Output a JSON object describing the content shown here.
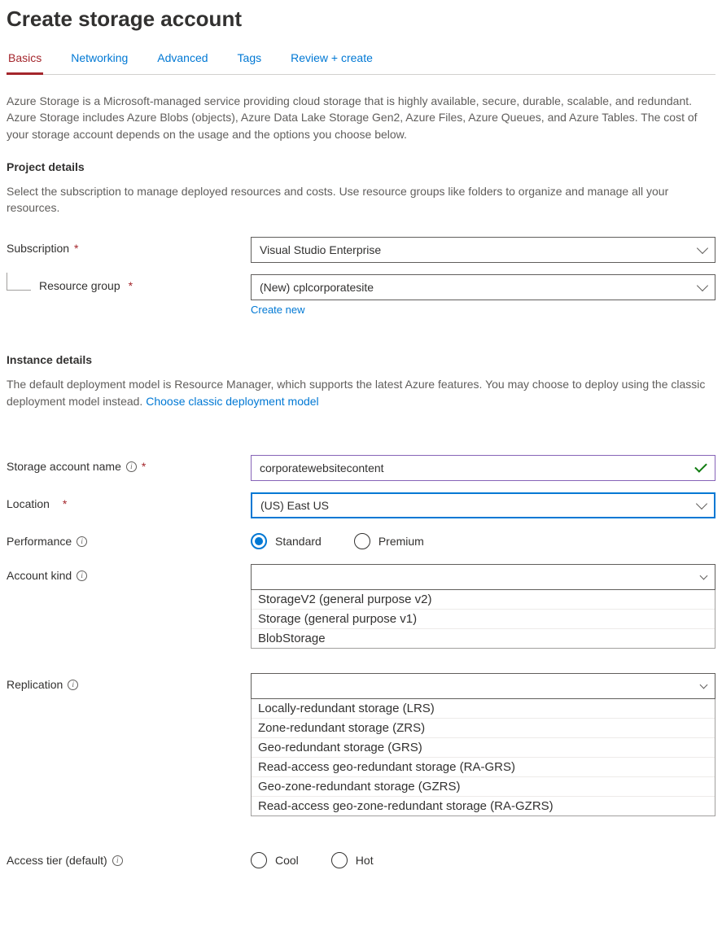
{
  "header": {
    "title": "Create storage account"
  },
  "tabs": [
    "Basics",
    "Networking",
    "Advanced",
    "Tags",
    "Review + create"
  ],
  "intro": "Azure Storage is a Microsoft-managed service providing cloud storage that is highly available, secure, durable, scalable, and redundant. Azure Storage includes Azure Blobs (objects), Azure Data Lake Storage Gen2, Azure Files, Azure Queues, and Azure Tables. The cost of your storage account depends on the usage and the options you choose below.",
  "project": {
    "heading": "Project details",
    "desc": "Select the subscription to manage deployed resources and costs. Use resource groups like folders to organize and manage all your resources.",
    "subscription_label": "Subscription",
    "subscription_value": "Visual Studio Enterprise",
    "resource_group_label": "Resource group",
    "resource_group_value": "(New) cplcorporatesite",
    "create_new": "Create new"
  },
  "instance": {
    "heading": "Instance details",
    "desc_prefix": "The default deployment model is Resource Manager, which supports the latest Azure features. You may choose to deploy using the classic deployment model instead.  ",
    "desc_link": "Choose classic deployment model",
    "name_label": "Storage account name",
    "name_value": "corporatewebsitecontent",
    "location_label": "Location",
    "location_value": "(US) East US",
    "performance_label": "Performance",
    "performance_options": [
      "Standard",
      "Premium"
    ],
    "performance_selected": "Standard",
    "account_kind_label": "Account kind",
    "account_kind_value": "",
    "account_kind_options": [
      "StorageV2 (general purpose v2)",
      "Storage (general purpose v1)",
      "BlobStorage"
    ],
    "replication_label": "Replication",
    "replication_value": "",
    "replication_options": [
      "Locally-redundant storage (LRS)",
      "Zone-redundant storage (ZRS)",
      "Geo-redundant storage (GRS)",
      "Read-access geo-redundant storage (RA-GRS)",
      "Geo-zone-redundant storage (GZRS)",
      "Read-access geo-zone-redundant storage (RA-GZRS)"
    ],
    "access_tier_label": "Access tier (default)",
    "access_tier_options": [
      "Cool",
      "Hot"
    ]
  }
}
